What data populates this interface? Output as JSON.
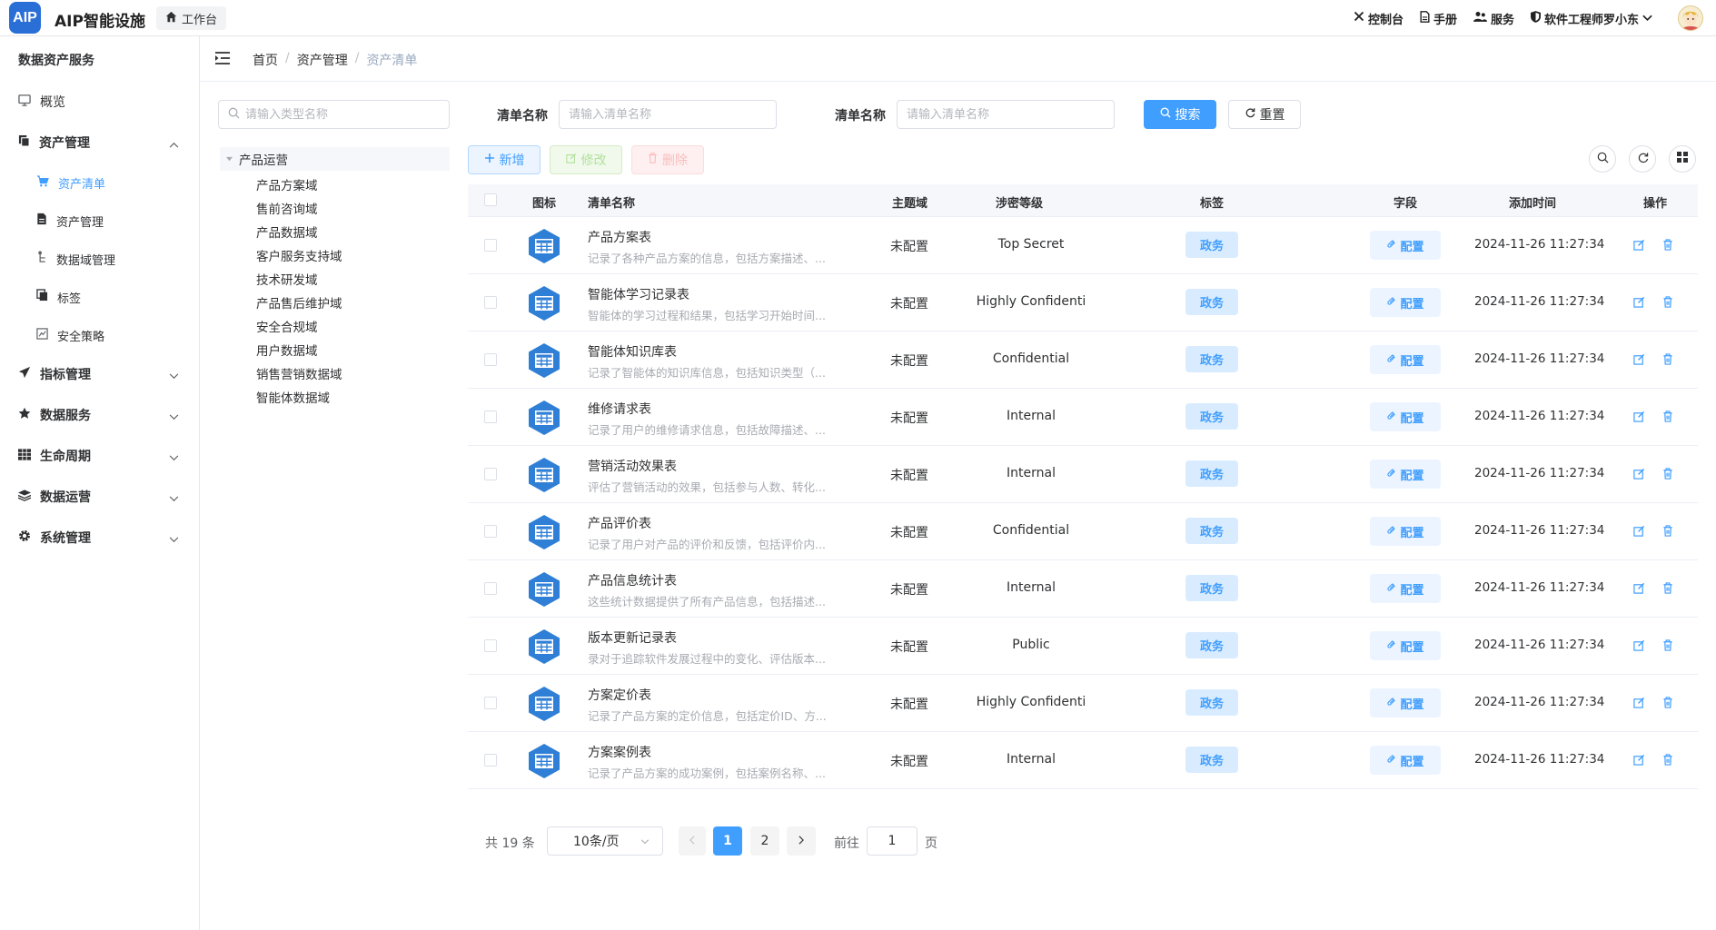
{
  "header": {
    "logo_text": "AIP",
    "app_title": "AIP智能设施",
    "workbench": "工作台",
    "links": {
      "console": "控制台",
      "manual": "手册",
      "service": "服务",
      "user": "软件工程师罗小东"
    }
  },
  "sidebar": {
    "title": "数据资产服务",
    "overview": "概览",
    "asset_mgmt": "资产管理",
    "sub": {
      "asset_list": "资产清单",
      "asset_manage": "资产管理",
      "domain_manage": "数据域管理",
      "tags": "标签",
      "security": "安全策略"
    },
    "metrics": "指标管理",
    "data_service": "数据服务",
    "lifecycle": "生命周期",
    "data_ops": "数据运营",
    "system": "系统管理"
  },
  "breadcrumb": {
    "home": "首页",
    "section": "资产管理",
    "current": "资产清单",
    "sep": "/"
  },
  "tree": {
    "search_placeholder": "请输入类型名称",
    "root": "产品运营",
    "nodes": [
      "产品方案域",
      "售前咨询域",
      "产品数据域",
      "客户服务支持域",
      "技术研发域",
      "产品售后维护域",
      "安全合规域",
      "用户数据域",
      "销售营销数据域",
      "智能体数据域"
    ]
  },
  "filters": {
    "label1": "清单名称",
    "placeholder1": "请输入清单名称",
    "label2": "清单名称",
    "placeholder2": "请输入清单名称",
    "search": "搜索",
    "reset": "重置"
  },
  "toolbar": {
    "add": "新增",
    "edit": "修改",
    "delete": "删除"
  },
  "table": {
    "headers": {
      "icon": "图标",
      "name": "清单名称",
      "domain": "主题域",
      "level": "涉密等级",
      "tag": "标签",
      "field": "字段",
      "time": "添加时间",
      "op": "操作"
    },
    "rows": [
      {
        "name": "产品方案表",
        "desc": "记录了各种产品方案的信息，包括方案描述、...",
        "domain": "未配置",
        "level": "Top Secret",
        "tag": "政务",
        "field": "配置",
        "time": "2024-11-26 11:27:34"
      },
      {
        "name": "智能体学习记录表",
        "desc": "智能体的学习过程和结果，包括学习开始时间...",
        "domain": "未配置",
        "level": "Highly Confidenti",
        "tag": "政务",
        "field": "配置",
        "time": "2024-11-26 11:27:34"
      },
      {
        "name": "智能体知识库表",
        "desc": "记录了智能体的知识库信息，包括知识类型（...",
        "domain": "未配置",
        "level": "Confidential",
        "tag": "政务",
        "field": "配置",
        "time": "2024-11-26 11:27:34"
      },
      {
        "name": "维修请求表",
        "desc": "记录了用户的维修请求信息，包括故障描述、...",
        "domain": "未配置",
        "level": "Internal",
        "tag": "政务",
        "field": "配置",
        "time": "2024-11-26 11:27:34"
      },
      {
        "name": "营销活动效果表",
        "desc": "评估了营销活动的效果，包括参与人数、转化...",
        "domain": "未配置",
        "level": "Internal",
        "tag": "政务",
        "field": "配置",
        "time": "2024-11-26 11:27:34"
      },
      {
        "name": "产品评价表",
        "desc": "记录了用户对产品的评价和反馈，包括评价内...",
        "domain": "未配置",
        "level": "Confidential",
        "tag": "政务",
        "field": "配置",
        "time": "2024-11-26 11:27:34"
      },
      {
        "name": "产品信息统计表",
        "desc": "这些统计数据提供了所有产品信息，包括描述...",
        "domain": "未配置",
        "level": "Internal",
        "tag": "政务",
        "field": "配置",
        "time": "2024-11-26 11:27:34"
      },
      {
        "name": "版本更新记录表",
        "desc": "录对于追踪软件发展过程中的变化、评估版本...",
        "domain": "未配置",
        "level": "Public",
        "tag": "政务",
        "field": "配置",
        "time": "2024-11-26 11:27:34"
      },
      {
        "name": "方案定价表",
        "desc": "记录了产品方案的定价信息，包括定价ID、方...",
        "domain": "未配置",
        "level": "Highly Confidenti",
        "tag": "政务",
        "field": "配置",
        "time": "2024-11-26 11:27:34"
      },
      {
        "name": "方案案例表",
        "desc": "记录了产品方案的成功案例，包括案例名称、...",
        "domain": "未配置",
        "level": "Internal",
        "tag": "政务",
        "field": "配置",
        "time": "2024-11-26 11:27:34"
      }
    ]
  },
  "pagination": {
    "total": "共 19 条",
    "page_size": "10条/页",
    "page1": "1",
    "page2": "2",
    "goto_label": "前往",
    "goto_value": "1",
    "page_suffix": "页"
  },
  "colors": {
    "primary": "#409eff",
    "icon_blue": "#2f7fd6",
    "tag_bg": "#d9ecff"
  }
}
